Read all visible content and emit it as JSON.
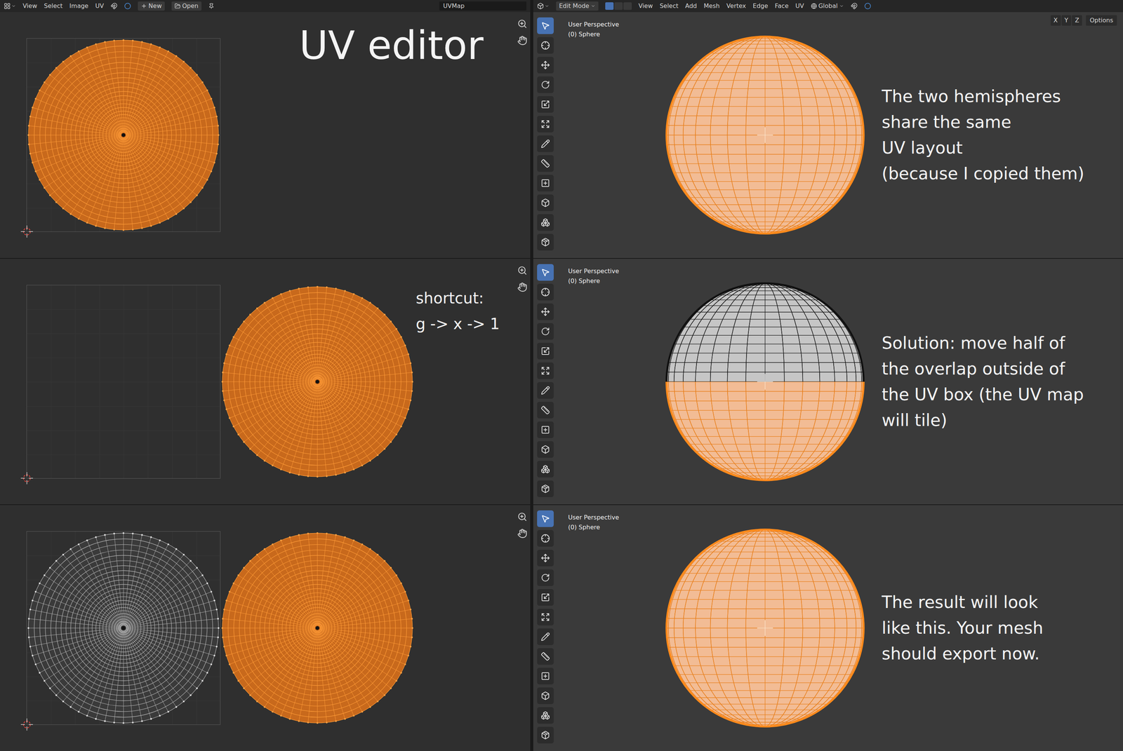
{
  "uv_editor_header": {
    "menus": [
      "View",
      "Select",
      "Image",
      "UV"
    ],
    "new_button": "New",
    "open_button": "Open",
    "uv_map": "UVMap"
  },
  "viewport_header": {
    "mode": "Edit Mode",
    "menus": [
      "View",
      "Select",
      "Add",
      "Mesh",
      "Vertex",
      "Edge",
      "Face",
      "UV"
    ],
    "orientation": "Global",
    "options": "Options",
    "axis_buttons": [
      "X",
      "Y",
      "Z"
    ]
  },
  "tools": [
    {
      "selected": true
    },
    {
      "selected": false
    },
    {
      "selected": false
    },
    {
      "selected": false
    },
    {
      "selected": false
    },
    {
      "selected": false
    },
    {
      "selected": false
    },
    {
      "selected": false
    },
    {
      "selected": false
    },
    {
      "selected": false
    },
    {
      "selected": false
    },
    {
      "selected": false
    }
  ],
  "steps": [
    {
      "uv_caption": {
        "kind": "title",
        "lines": [
          "UV editor"
        ]
      },
      "islands": [
        {
          "place": "inside",
          "selected": true
        }
      ],
      "view_labels": [
        "User Perspective",
        "(0) Sphere"
      ],
      "show_overlay_buttons": true,
      "sphere": {
        "top_selected": true,
        "bottom_selected": true
      },
      "note_lines": [
        "The two hemispheres",
        "share the same",
        "UV layout",
        "(because I copied them)"
      ]
    },
    {
      "uv_caption": {
        "kind": "shortcut",
        "lines": [
          "shortcut:",
          "g -> x -> 1"
        ]
      },
      "islands": [
        {
          "place": "outside",
          "selected": true
        }
      ],
      "view_labels": [
        "User Perspective",
        "(0) Sphere"
      ],
      "show_overlay_buttons": false,
      "sphere": {
        "top_selected": false,
        "bottom_selected": true
      },
      "note_lines": [
        "Solution: move half of",
        "the overlap outside of",
        "the UV box (the UV map",
        "will tile)"
      ]
    },
    {
      "uv_caption": {
        "kind": "none",
        "lines": []
      },
      "islands": [
        {
          "place": "inside",
          "selected": false
        },
        {
          "place": "outside",
          "selected": true
        }
      ],
      "view_labels": [
        "User Perspective",
        "(0) Sphere"
      ],
      "show_overlay_buttons": false,
      "sphere": {
        "top_selected": true,
        "bottom_selected": true
      },
      "note_lines": [
        "The result will look",
        "like this. Your mesh",
        "should export now."
      ]
    }
  ]
}
